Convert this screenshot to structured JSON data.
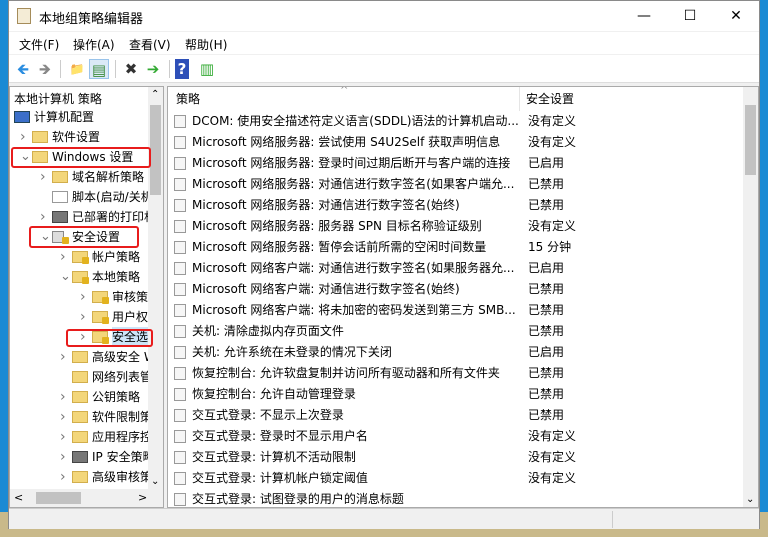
{
  "window": {
    "title": "本地组策略编辑器",
    "minimize": "—",
    "maximize": "☐",
    "close": "✕"
  },
  "menu": [
    "文件(F)",
    "操作(A)",
    "查看(V)",
    "帮助(H)"
  ],
  "toolbar": {
    "back": "🡸",
    "forward": "🡺",
    "up": "📁",
    "show_hide": "▤",
    "delete": "✖",
    "export": "➔",
    "help": "?",
    "properties": "▥"
  },
  "tree": {
    "header": "本地计算机 策略",
    "items": [
      {
        "label": "计算机配置",
        "level": 0,
        "chevron": ""
      },
      {
        "label": "软件设置",
        "level": 1,
        "chevron": ">"
      },
      {
        "label": "Windows 设置",
        "level": 1,
        "chevron": "v"
      },
      {
        "label": "域名解析策略",
        "level": 2,
        "chevron": ">"
      },
      {
        "label": "脚本(启动/关机)",
        "level": 2,
        "chevron": ""
      },
      {
        "label": "已部署的打印机",
        "level": 2,
        "chevron": ">"
      },
      {
        "label": "安全设置",
        "level": 2,
        "chevron": "v"
      },
      {
        "label": "帐户策略",
        "level": 3,
        "chevron": ">"
      },
      {
        "label": "本地策略",
        "level": 3,
        "chevron": "v"
      },
      {
        "label": "审核策略",
        "level": 4,
        "chevron": ">"
      },
      {
        "label": "用户权限分配",
        "level": 4,
        "chevron": ">"
      },
      {
        "label": "安全选项",
        "level": 4,
        "chevron": ">"
      },
      {
        "label": "高级安全 Windows 防火墙",
        "level": 3,
        "chevron": ">"
      },
      {
        "label": "网络列表管理器策略",
        "level": 3,
        "chevron": ""
      },
      {
        "label": "公钥策略",
        "level": 3,
        "chevron": ">"
      },
      {
        "label": "软件限制策略",
        "level": 3,
        "chevron": ">"
      },
      {
        "label": "应用程序控制策略",
        "level": 3,
        "chevron": ">"
      },
      {
        "label": "IP 安全策略",
        "level": 3,
        "chevron": ">"
      },
      {
        "label": "高级审核策略配置",
        "level": 3,
        "chevron": ">"
      }
    ]
  },
  "list": {
    "col_policy": "策略",
    "col_setting": "安全设置",
    "rows": [
      [
        "DCOM: 使用安全描述符定义语言(SDDL)语法的计算机启动...",
        "没有定义"
      ],
      [
        "Microsoft 网络服务器: 尝试使用 S4U2Self 获取声明信息",
        "没有定义"
      ],
      [
        "Microsoft 网络服务器: 登录时间过期后断开与客户端的连接",
        "已启用"
      ],
      [
        "Microsoft 网络服务器: 对通信进行数字签名(如果客户端允...",
        "已禁用"
      ],
      [
        "Microsoft 网络服务器: 对通信进行数字签名(始终)",
        "已禁用"
      ],
      [
        "Microsoft 网络服务器: 服务器 SPN 目标名称验证级别",
        "没有定义"
      ],
      [
        "Microsoft 网络服务器: 暂停会话前所需的空闲时间数量",
        "15 分钟"
      ],
      [
        "Microsoft 网络客户端: 对通信进行数字签名(如果服务器允...",
        "已启用"
      ],
      [
        "Microsoft 网络客户端: 对通信进行数字签名(始终)",
        "已禁用"
      ],
      [
        "Microsoft 网络客户端: 将未加密的密码发送到第三方 SMB...",
        "已禁用"
      ],
      [
        "关机: 清除虚拟内存页面文件",
        "已禁用"
      ],
      [
        "关机: 允许系统在未登录的情况下关闭",
        "已启用"
      ],
      [
        "恢复控制台: 允许软盘复制并访问所有驱动器和所有文件夹",
        "已禁用"
      ],
      [
        "恢复控制台: 允许自动管理登录",
        "已禁用"
      ],
      [
        "交互式登录: 不显示上次登录",
        "已禁用"
      ],
      [
        "交互式登录: 登录时不显示用户名",
        "没有定义"
      ],
      [
        "交互式登录: 计算机不活动限制",
        "没有定义"
      ],
      [
        "交互式登录: 计算机帐户锁定阈值",
        "没有定义"
      ],
      [
        "交互式登录: 试图登录的用户的消息标题",
        ""
      ]
    ]
  }
}
